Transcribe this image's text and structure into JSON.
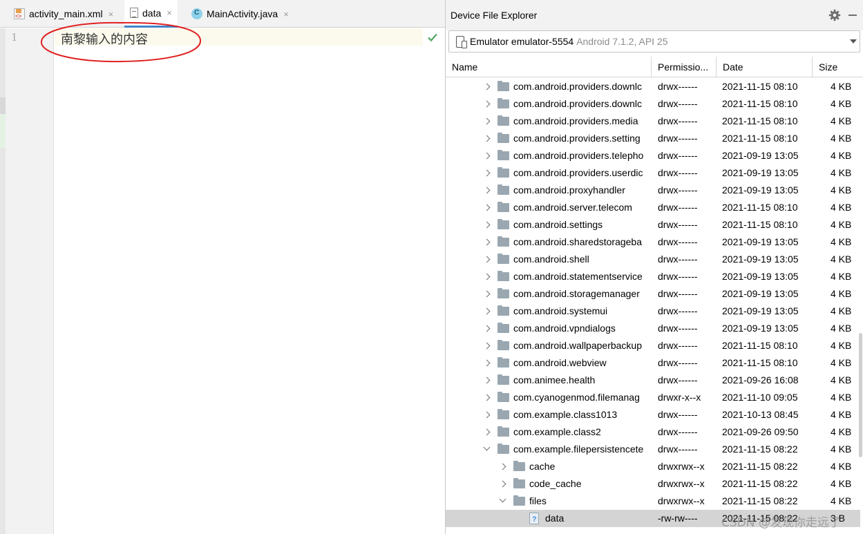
{
  "editor": {
    "tabs": [
      {
        "label": "activity_main.xml",
        "icon": "xml-file-icon"
      },
      {
        "label": "data",
        "icon": "text-file-icon"
      },
      {
        "label": "MainActivity.java",
        "icon": "java-class-icon"
      }
    ],
    "close_glyph": "×",
    "line_number": "1",
    "content": "南黎输入的内容",
    "annotation": "red ellipse around content"
  },
  "explorer": {
    "title": "Device File Explorer",
    "device_name": "Emulator emulator-5554",
    "device_info": "Android 7.1.2, API 25",
    "columns": [
      "Name",
      "Permissio...",
      "Date",
      "Size"
    ],
    "rows": [
      {
        "level": 1,
        "state": "collapsed",
        "type": "folder",
        "name": "com.android.providers.downlc",
        "perm": "drwx------",
        "date": "2021-11-15 08:10",
        "size": "4 KB"
      },
      {
        "level": 1,
        "state": "collapsed",
        "type": "folder",
        "name": "com.android.providers.downlc",
        "perm": "drwx------",
        "date": "2021-11-15 08:10",
        "size": "4 KB"
      },
      {
        "level": 1,
        "state": "collapsed",
        "type": "folder",
        "name": "com.android.providers.media",
        "perm": "drwx------",
        "date": "2021-11-15 08:10",
        "size": "4 KB"
      },
      {
        "level": 1,
        "state": "collapsed",
        "type": "folder",
        "name": "com.android.providers.setting",
        "perm": "drwx------",
        "date": "2021-11-15 08:10",
        "size": "4 KB"
      },
      {
        "level": 1,
        "state": "collapsed",
        "type": "folder",
        "name": "com.android.providers.telepho",
        "perm": "drwx------",
        "date": "2021-09-19 13:05",
        "size": "4 KB"
      },
      {
        "level": 1,
        "state": "collapsed",
        "type": "folder",
        "name": "com.android.providers.userdic",
        "perm": "drwx------",
        "date": "2021-09-19 13:05",
        "size": "4 KB"
      },
      {
        "level": 1,
        "state": "collapsed",
        "type": "folder",
        "name": "com.android.proxyhandler",
        "perm": "drwx------",
        "date": "2021-09-19 13:05",
        "size": "4 KB"
      },
      {
        "level": 1,
        "state": "collapsed",
        "type": "folder",
        "name": "com.android.server.telecom",
        "perm": "drwx------",
        "date": "2021-11-15 08:10",
        "size": "4 KB"
      },
      {
        "level": 1,
        "state": "collapsed",
        "type": "folder",
        "name": "com.android.settings",
        "perm": "drwx------",
        "date": "2021-11-15 08:10",
        "size": "4 KB"
      },
      {
        "level": 1,
        "state": "collapsed",
        "type": "folder",
        "name": "com.android.sharedstorageba",
        "perm": "drwx------",
        "date": "2021-09-19 13:05",
        "size": "4 KB"
      },
      {
        "level": 1,
        "state": "collapsed",
        "type": "folder",
        "name": "com.android.shell",
        "perm": "drwx------",
        "date": "2021-09-19 13:05",
        "size": "4 KB"
      },
      {
        "level": 1,
        "state": "collapsed",
        "type": "folder",
        "name": "com.android.statementservice",
        "perm": "drwx------",
        "date": "2021-09-19 13:05",
        "size": "4 KB"
      },
      {
        "level": 1,
        "state": "collapsed",
        "type": "folder",
        "name": "com.android.storagemanager",
        "perm": "drwx------",
        "date": "2021-09-19 13:05",
        "size": "4 KB"
      },
      {
        "level": 1,
        "state": "collapsed",
        "type": "folder",
        "name": "com.android.systemui",
        "perm": "drwx------",
        "date": "2021-09-19 13:05",
        "size": "4 KB"
      },
      {
        "level": 1,
        "state": "collapsed",
        "type": "folder",
        "name": "com.android.vpndialogs",
        "perm": "drwx------",
        "date": "2021-09-19 13:05",
        "size": "4 KB"
      },
      {
        "level": 1,
        "state": "collapsed",
        "type": "folder",
        "name": "com.android.wallpaperbackup",
        "perm": "drwx------",
        "date": "2021-11-15 08:10",
        "size": "4 KB"
      },
      {
        "level": 1,
        "state": "collapsed",
        "type": "folder",
        "name": "com.android.webview",
        "perm": "drwx------",
        "date": "2021-11-15 08:10",
        "size": "4 KB"
      },
      {
        "level": 1,
        "state": "collapsed",
        "type": "folder",
        "name": "com.animee.health",
        "perm": "drwx------",
        "date": "2021-09-26 16:08",
        "size": "4 KB"
      },
      {
        "level": 1,
        "state": "collapsed",
        "type": "folder",
        "name": "com.cyanogenmod.filemanag",
        "perm": "drwxr-x--x",
        "date": "2021-11-10 09:05",
        "size": "4 KB"
      },
      {
        "level": 1,
        "state": "collapsed",
        "type": "folder",
        "name": "com.example.class1013",
        "perm": "drwx------",
        "date": "2021-10-13 08:45",
        "size": "4 KB"
      },
      {
        "level": 1,
        "state": "collapsed",
        "type": "folder",
        "name": "com.example.class2",
        "perm": "drwx------",
        "date": "2021-09-26 09:50",
        "size": "4 KB"
      },
      {
        "level": 1,
        "state": "expanded",
        "type": "folder",
        "name": "com.example.filepersistencete",
        "perm": "drwx------",
        "date": "2021-11-15 08:22",
        "size": "4 KB"
      },
      {
        "level": 2,
        "state": "collapsed",
        "type": "folder",
        "name": "cache",
        "perm": "drwxrwx--x",
        "date": "2021-11-15 08:22",
        "size": "4 KB"
      },
      {
        "level": 2,
        "state": "collapsed",
        "type": "folder",
        "name": "code_cache",
        "perm": "drwxrwx--x",
        "date": "2021-11-15 08:22",
        "size": "4 KB"
      },
      {
        "level": 2,
        "state": "expanded",
        "type": "folder",
        "name": "files",
        "perm": "drwxrwx--x",
        "date": "2021-11-15 08:22",
        "size": "4 KB"
      },
      {
        "level": 3,
        "state": "none",
        "type": "file",
        "name": "data",
        "perm": "-rw-rw----",
        "date": "2021-11-15 08:22",
        "size": "3 B",
        "selected": true
      }
    ]
  },
  "watermark": "CSDN @发现你走远了",
  "colors": {
    "accent_tab": "#4083c9",
    "annotation_red": "#e02020",
    "check_green": "#59a869",
    "selected_row": "#d4d4d4"
  }
}
